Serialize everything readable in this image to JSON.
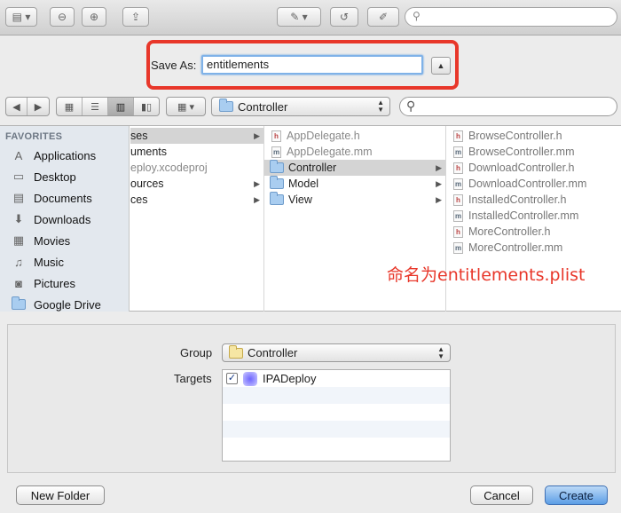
{
  "toolbar": {
    "buttons": [
      "sidebar-toggle",
      "zoom-out",
      "zoom-in",
      "share",
      "edit",
      "undo",
      "annotate"
    ]
  },
  "save_as": {
    "label": "Save As:",
    "value": "entitlements"
  },
  "nav": {
    "current_folder": "Controller"
  },
  "sidebar": {
    "heading": "FAVORITES",
    "items": [
      {
        "label": "Applications",
        "icon": "applications-icon"
      },
      {
        "label": "Desktop",
        "icon": "desktop-icon"
      },
      {
        "label": "Documents",
        "icon": "documents-icon"
      },
      {
        "label": "Downloads",
        "icon": "downloads-icon"
      },
      {
        "label": "Movies",
        "icon": "movies-icon"
      },
      {
        "label": "Music",
        "icon": "music-icon"
      },
      {
        "label": "Pictures",
        "icon": "pictures-icon"
      },
      {
        "label": "Google Drive",
        "icon": "google-drive-icon"
      }
    ]
  },
  "columns": {
    "col1": [
      {
        "label": "ses",
        "selected": true,
        "chevron": true
      },
      {
        "label": "uments",
        "selected": false,
        "chevron": false
      },
      {
        "label": "eploy.xcodeproj",
        "selected": false,
        "chevron": false,
        "dim": true
      },
      {
        "label": "ources",
        "selected": false,
        "chevron": true
      },
      {
        "label": "ces",
        "selected": false,
        "chevron": true
      }
    ],
    "col2": [
      {
        "label": "AppDelegate.h",
        "type": "h",
        "dim": true
      },
      {
        "label": "AppDelegate.mm",
        "type": "m",
        "dim": true
      },
      {
        "label": "Controller",
        "type": "folder",
        "selected": true,
        "chevron": true
      },
      {
        "label": "Model",
        "type": "folder",
        "chevron": true
      },
      {
        "label": "View",
        "type": "folder",
        "chevron": true
      }
    ],
    "col3": [
      {
        "label": "BrowseController.h",
        "type": "h"
      },
      {
        "label": "BrowseController.mm",
        "type": "m"
      },
      {
        "label": "DownloadController.h",
        "type": "h"
      },
      {
        "label": "DownloadController.mm",
        "type": "m"
      },
      {
        "label": "InstalledController.h",
        "type": "h"
      },
      {
        "label": "InstalledController.mm",
        "type": "m"
      },
      {
        "label": "MoreController.h",
        "type": "h"
      },
      {
        "label": "MoreController.mm",
        "type": "m"
      }
    ]
  },
  "annotation": "命名为entitlements.plist",
  "options": {
    "group_label": "Group",
    "group_value": "Controller",
    "targets_label": "Targets",
    "targets": [
      {
        "name": "IPADeploy",
        "checked": true
      }
    ]
  },
  "buttons": {
    "new_folder": "New Folder",
    "cancel": "Cancel",
    "create": "Create"
  },
  "colors": {
    "highlight": "#e8372a",
    "primary_button": "#5c9ee6",
    "sidebar_bg": "#e3e8ee"
  }
}
